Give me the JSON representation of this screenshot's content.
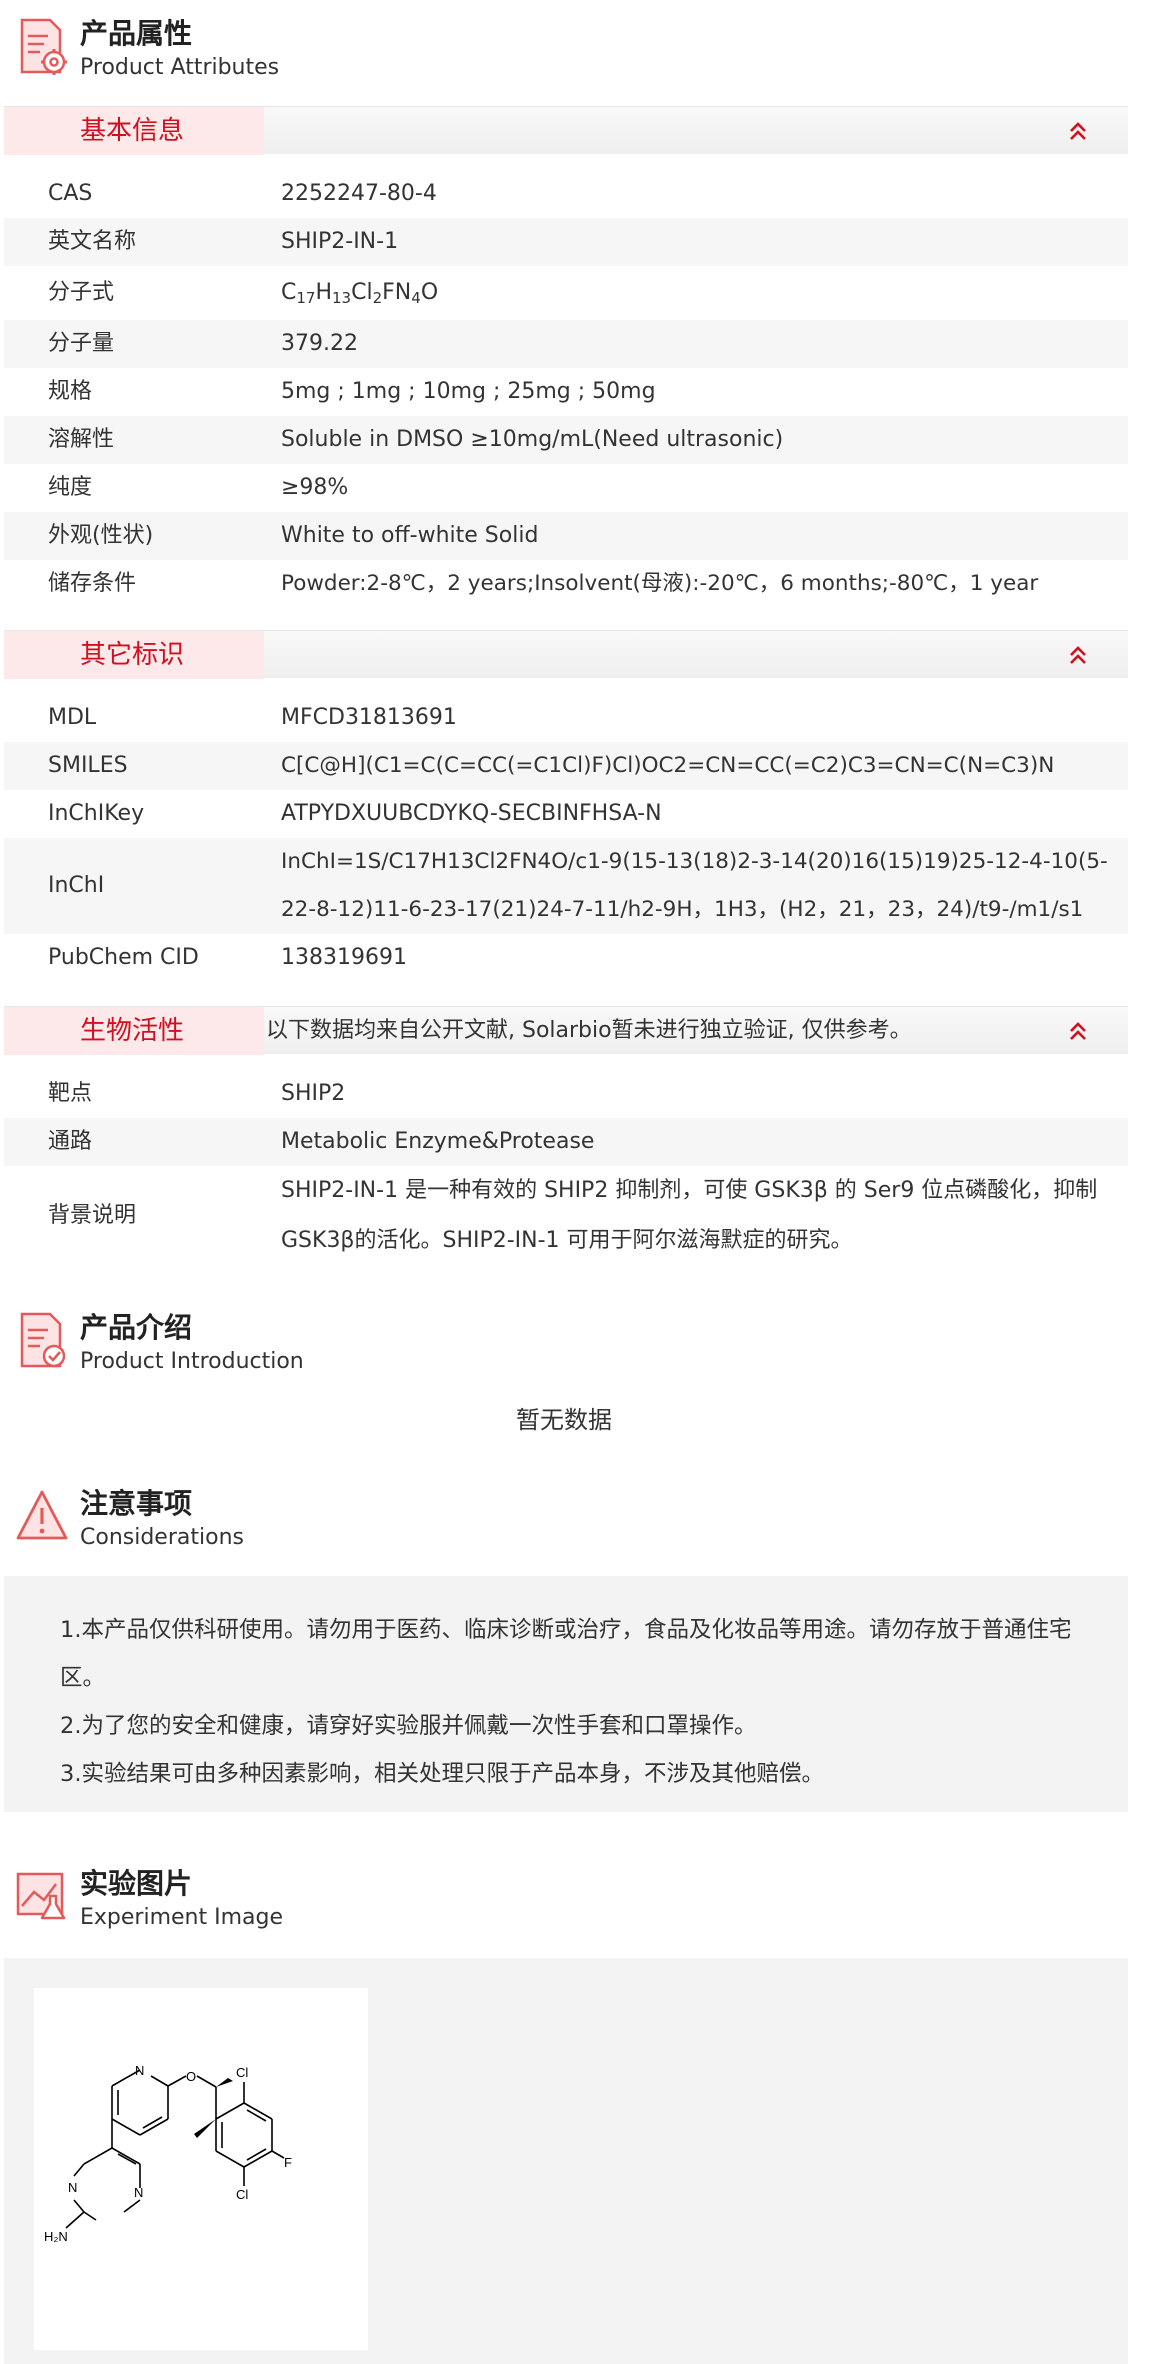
{
  "attributes": {
    "title_zh": "产品属性",
    "title_en": "Product Attributes",
    "basic": {
      "label": "基本信息",
      "rows": [
        {
          "key": "CAS",
          "value": "2252247-80-4"
        },
        {
          "key": "英文名称",
          "value": "SHIP2-IN-1"
        },
        {
          "key": "分子式",
          "value": "C17H13Cl2FN4O"
        },
        {
          "key": "分子量",
          "value": "379.22"
        },
        {
          "key": "规格",
          "value": "5mg ; 1mg ; 10mg ; 25mg ; 50mg"
        },
        {
          "key": "溶解性",
          "value": "Soluble in DMSO ≥10mg/mL(Need ultrasonic)"
        },
        {
          "key": "纯度",
          "value": "≥98%"
        },
        {
          "key": "外观(性状)",
          "value": "White to off-white Solid"
        },
        {
          "key": "储存条件",
          "value": "Powder:2-8℃，2 years;Insolvent(母液):-20℃，6 months;-80℃，1 year"
        }
      ]
    },
    "other": {
      "label": "其它标识",
      "rows": [
        {
          "key": "MDL",
          "value": "MFCD31813691"
        },
        {
          "key": "SMILES",
          "value": "C[C@H](C1=C(C=CC(=C1Cl)F)Cl)OC2=CN=CC(=C2)C3=CN=C(N=C3)N"
        },
        {
          "key": "InChIKey",
          "value": "ATPYDXUUBCDYKQ-SECBINFHSA-N"
        },
        {
          "key": "InChI",
          "value": "InChI=1S/C17H13Cl2FN4O/c1-9(15-13(18)2-3-14(20)16(15)19)25-12-4-10(5-22-8-12)11-6-23-17(21)24-7-11/h2-9H，1H3，(H2，21，23，24)/t9-/m1/s1"
        },
        {
          "key": "PubChem CID",
          "value": "138319691"
        }
      ]
    },
    "bio": {
      "label": "生物活性",
      "note": "以下数据均来自公开文献, Solarbio暂未进行独立验证, 仅供参考。",
      "rows": [
        {
          "key": "靶点",
          "value": "SHIP2"
        },
        {
          "key": "通路",
          "value": "Metabolic Enzyme&Protease"
        },
        {
          "key": "背景说明",
          "value": "SHIP2-IN-1 是一种有效的 SHIP2 抑制剂，可使 GSK3β 的 Ser9 位点磷酸化，抑制 GSK3β的活化。SHIP2-IN-1 可用于阿尔滋海默症的研究。"
        }
      ]
    }
  },
  "intro": {
    "title_zh": "产品介绍",
    "title_en": "Product Introduction",
    "empty_text": "暂无数据"
  },
  "considerations": {
    "title_zh": "注意事项",
    "title_en": "Considerations",
    "items": [
      "1.本产品仅供科研使用。请勿用于医药、临床诊断或治疗，食品及化妆品等用途。请勿存放于普通住宅区。",
      "2.为了您的安全和健康，请穿好实验服并佩戴一次性手套和口罩操作。",
      "3.实验结果可由多种因素影响，相关处理只限于产品本身，不涉及其他赔偿。"
    ]
  },
  "experiment": {
    "title_zh": "实验图片",
    "title_en": "Experiment Image",
    "structure_labels": {
      "n_top": "N",
      "o": "O",
      "cl_top": "Cl",
      "cl_bottom": "Cl",
      "f": "F",
      "n_left": "N",
      "n_right": "N",
      "nh2": "H₂N"
    }
  },
  "colors": {
    "accent": "#d1101f",
    "category_bg": "#fde9ea",
    "stripe": "#f6f6f6"
  },
  "icons": {
    "attributes": "document-gear-icon",
    "intro": "document-check-icon",
    "considerations": "warning-triangle-icon",
    "experiment": "image-flask-icon",
    "collapse": "double-chevron-up-icon"
  }
}
